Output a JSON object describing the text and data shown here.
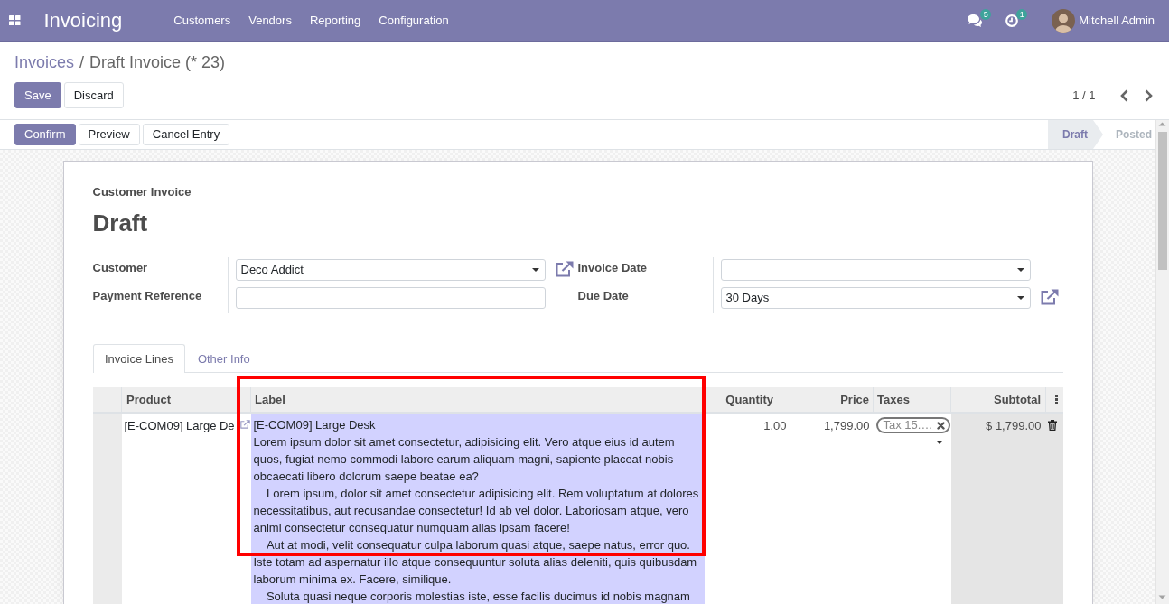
{
  "navbar": {
    "app_title": "Invoicing",
    "menu": [
      "Customers",
      "Vendors",
      "Reporting",
      "Configuration"
    ],
    "systray": [
      {
        "kind": "messages",
        "count": "5"
      },
      {
        "kind": "activities",
        "count": "1"
      }
    ],
    "user_name": "Mitchell Admin"
  },
  "breadcrumb": {
    "items": [
      {
        "label": "Invoices",
        "link": true
      },
      {
        "label": "Draft Invoice (* 23)",
        "link": false
      }
    ],
    "separator": "/"
  },
  "form_buttons": [
    {
      "label": "Save",
      "kind": "primary"
    },
    {
      "label": "Discard",
      "kind": "secondary"
    }
  ],
  "pager": {
    "value": "1 / 1"
  },
  "action_buttons": [
    {
      "label": "Confirm",
      "kind": "primary"
    },
    {
      "label": "Preview",
      "kind": "secondary"
    },
    {
      "label": "Cancel Entry",
      "kind": "secondary"
    }
  ],
  "status_steps": [
    {
      "label": "Draft",
      "selected": true
    },
    {
      "label": "Posted",
      "selected": false
    }
  ],
  "sheet": {
    "document_type": "Customer Invoice",
    "title": "Draft",
    "field_groups": [
      {
        "fields": [
          {
            "label": "Customer",
            "kind": "many2one",
            "value": "Deco Addict"
          },
          {
            "label": "Payment Reference",
            "kind": "text"
          }
        ]
      },
      {
        "fields": [
          {
            "label": "Invoice Date",
            "kind": "dropdown"
          },
          {
            "label": "Due Date",
            "kind": "many2one",
            "value": "30 Days"
          }
        ]
      }
    ],
    "tabs": [
      {
        "label": "Invoice Lines",
        "selected": true
      },
      {
        "label": "Other Info",
        "selected": false
      }
    ],
    "lines": {
      "columns": [
        {
          "label": "Product",
          "highlighted": false
        },
        {
          "label": "Label",
          "highlighted": true
        },
        {
          "label": "Quantity",
          "highlighted": false
        },
        {
          "label": "Price",
          "highlighted": false
        },
        {
          "label": "Taxes",
          "highlighted": false
        },
        {
          "label": "Subtotal",
          "highlighted": false
        }
      ],
      "rows": [
        {
          "product": "[E-COM09] Large De",
          "label": "[E-COM09] Large Desk\nLorem ipsum dolor sit amet consectetur, adipisicing elit. Vero atque eius id autem quos, fugiat nemo commodi labore earum aliquam magni, sapiente placeat nobis obcaecati libero dolorum saepe beatae ea?\n    Lorem ipsum, dolor sit amet consectetur adipisicing elit. Rem voluptatum at dolores necessitatibus, aut recusandae consectetur! Id ab vel dolor. Laboriosam atque, vero animi consectetur consequatur numquam alias ipsam facere!\n    Aut at modi, velit consequatur culpa laborum quasi atque, saepe natus, error quo. Iste totam ad aspernatur illo atque consequuntur soluta alias deleniti, quis quibusdam laborum minima ex. Facere, similique.\n    Soluta quasi neque corporis molestias iste, esse facilis ducimus id nobis magnam",
          "label_required": true,
          "quantity": "1.00",
          "price": "1,799.00",
          "taxes": [
            "Tax 15.…"
          ],
          "subtotal": "$ 1,799.00"
        }
      ]
    }
  }
}
